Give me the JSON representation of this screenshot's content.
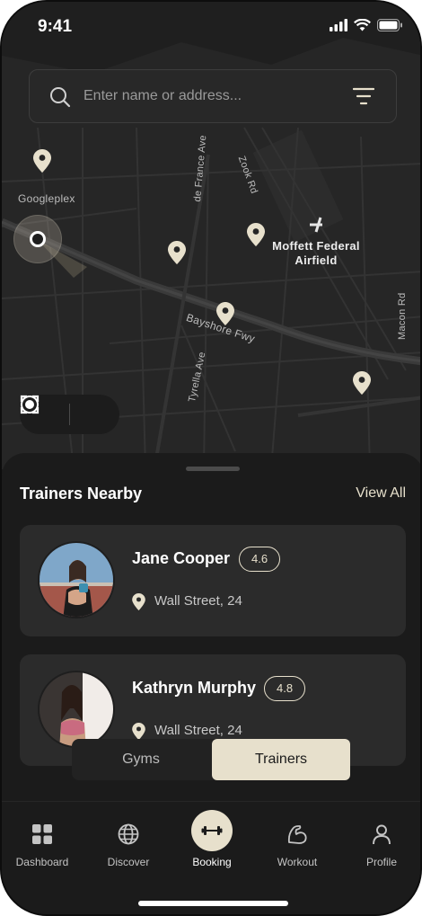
{
  "status": {
    "time": "9:41"
  },
  "search": {
    "placeholder": "Enter name or address..."
  },
  "map": {
    "labels": {
      "googleplex": "Googleplex",
      "de_france": "de France Ave",
      "zook": "Zook Rd",
      "moffett": "Moffett Federal Airfield",
      "bayshore": "Bayshore Fwy",
      "tyrella": "Tyrella Ave",
      "macon": "Macon Rd"
    }
  },
  "nearby": {
    "title": "Trainers Nearby",
    "view_all": "View All",
    "trainers": [
      {
        "name": "Jane Cooper",
        "rating": "4.6",
        "address": "Wall Street, 24"
      },
      {
        "name": "Kathryn Murphy",
        "rating": "4.8",
        "address": "Wall Street, 24"
      }
    ]
  },
  "toggle": {
    "gyms": "Gyms",
    "trainers": "Trainers",
    "selected": "Trainers"
  },
  "tabs": [
    {
      "label": "Dashboard",
      "icon": "grid-icon"
    },
    {
      "label": "Discover",
      "icon": "globe-icon"
    },
    {
      "label": "Booking",
      "icon": "dumbbell-icon",
      "active": true
    },
    {
      "label": "Workout",
      "icon": "bicep-icon"
    },
    {
      "label": "Profile",
      "icon": "user-icon"
    }
  ],
  "colors": {
    "accent": "#e7e0cc",
    "background": "#1b1b1b",
    "map": "#262626",
    "card": "#2b2b2b"
  }
}
